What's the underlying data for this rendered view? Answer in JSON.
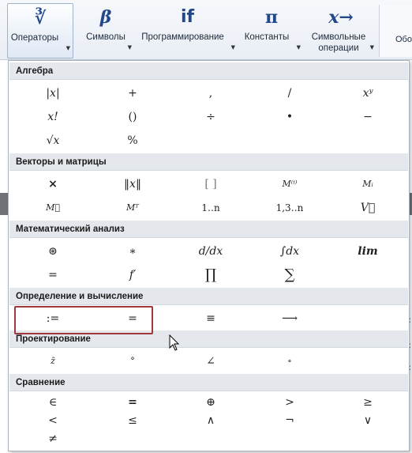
{
  "ribbon": {
    "buttons": [
      {
        "glyph": "∛",
        "label": "Операторы",
        "active": true
      },
      {
        "glyph": "β",
        "label": "Символы"
      },
      {
        "glyph": "if",
        "label": "Программирование"
      },
      {
        "glyph": "π",
        "label": "Константы"
      },
      {
        "glyph": "x→",
        "label": "Символьные",
        "label2": "операции"
      }
    ],
    "right_label": "Обо"
  },
  "sections": [
    {
      "title": "Алгебра",
      "rows": [
        [
          "|x|",
          "+",
          ",",
          "/",
          "xʸ"
        ],
        [
          "x!",
          "()",
          "÷",
          "•",
          "−"
        ],
        [
          "√x",
          "%",
          "",
          "",
          ""
        ]
      ]
    },
    {
      "title": "Векторы и матрицы",
      "rows": [
        [
          "×",
          "‖x‖",
          "[ ]",
          "M⁽ⁱ⁾",
          "Mᵢ"
        ],
        [
          "M⃗",
          "Mᵀ",
          "1‥n",
          "1,3‥n",
          "V⃗"
        ]
      ]
    },
    {
      "title": "Математический анализ",
      "rows": [
        [
          "⊛",
          "∗",
          "d/dx",
          "∫dx",
          "lim"
        ],
        [
          "=",
          "f′",
          "∏",
          "∑",
          ""
        ]
      ]
    },
    {
      "title": "Определение и вычисление",
      "rows": [
        [
          ":=",
          "=",
          "≡",
          "⟶",
          ""
        ]
      ]
    },
    {
      "title": "Проектирование",
      "rows": [
        [
          "z̄",
          "°",
          "∠",
          "∘",
          ""
        ]
      ]
    },
    {
      "title": "Сравнение",
      "rows": [
        [
          "∈",
          "=",
          "⊕",
          ">",
          "≥"
        ],
        [
          "<",
          "≤",
          "∧",
          "¬",
          "∨"
        ],
        [
          "≠",
          "",
          "",
          "",
          ""
        ]
      ]
    }
  ],
  "colors": {
    "accent": "#22488a",
    "highlight_border": "#a0383c",
    "section_header_bg": "#e4e8ed"
  }
}
